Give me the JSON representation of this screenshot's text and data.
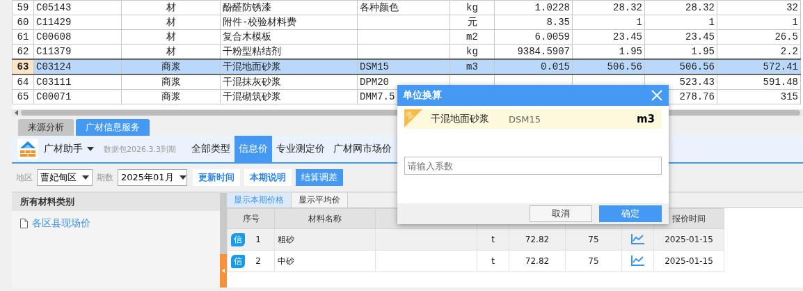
{
  "grid": {
    "rows": [
      {
        "number": "59",
        "selected": false,
        "cells": [
          "C05143",
          "材",
          "酚醛防锈漆",
          "各种颜色",
          "kg",
          "1.0228",
          "28.32",
          "28.32",
          "32"
        ]
      },
      {
        "number": "60",
        "selected": false,
        "cells": [
          "C11429",
          "材",
          "附件-校验材料费",
          null,
          "元",
          "8.35",
          "1",
          "1",
          "1"
        ]
      },
      {
        "number": "61",
        "selected": false,
        "cells": [
          "C00608",
          "材",
          "复合木模板",
          null,
          "m2",
          "6.0059",
          "23.45",
          "23.45",
          "26.5"
        ]
      },
      {
        "number": "62",
        "selected": false,
        "cells": [
          "C11379",
          "材",
          "干粉型粘结剂",
          null,
          "kg",
          "9384.5907",
          "1.95",
          "1.95",
          "2.2"
        ]
      },
      {
        "number": "63",
        "selected": true,
        "cells": [
          "C03124",
          "商浆",
          "干混地面砂浆",
          "DSM15",
          "m3",
          "0.015",
          "506.56",
          "506.56",
          "572.41"
        ]
      },
      {
        "number": "64",
        "selected": false,
        "cells": [
          "C03111",
          "商浆",
          "干混抹灰砂浆",
          "DPM20",
          null,
          null,
          null,
          "523.43",
          "591.48"
        ]
      },
      {
        "number": "65",
        "selected": false,
        "cells": [
          "C00071",
          "商浆",
          "干混砌筑砂浆",
          "DMM7.5",
          null,
          null,
          null,
          "278.76",
          "315"
        ]
      }
    ]
  },
  "panel_tabs": [
    {
      "label": "来源分析",
      "selected": false
    },
    {
      "label": "广材信息服务",
      "selected": true
    }
  ],
  "toolbar": {
    "app_name": "广材助手",
    "expiry": "数据包2026.3.3到期",
    "nav": [
      {
        "label": "全部类型",
        "selected": false
      },
      {
        "label": "信息价",
        "selected": true
      },
      {
        "label": "专业测定价",
        "selected": false
      },
      {
        "label": "广材网市场价",
        "selected": false
      }
    ]
  },
  "filters": {
    "region_label": "地区",
    "region": "曹妃甸区",
    "period_label": "期数",
    "period": "2025年01月",
    "buttons": [
      {
        "label": "更新时间",
        "primary": false
      },
      {
        "label": "本期说明",
        "primary": false
      },
      {
        "label": "结算调差",
        "primary": true
      }
    ]
  },
  "sidebar": {
    "header": "所有材料类别",
    "items": [
      {
        "label": "各区县现场价"
      }
    ]
  },
  "view_tabs": [
    {
      "label": "显示本期价格",
      "selected": true
    },
    {
      "label": "显示平均价",
      "selected": false
    }
  ],
  "price_table": {
    "columns": [
      "序号",
      "材料名称",
      null,
      null,
      null,
      null,
      null,
      "报价时间"
    ],
    "rows": [
      {
        "badge": "信",
        "index": "1",
        "name": "粗砂",
        "unit": "t",
        "price_1": "72.82",
        "price_2": "75",
        "date": "2025-01-15"
      },
      {
        "badge": "信",
        "index": "2",
        "name": "中砂",
        "unit": "t",
        "price_1": "72.82",
        "price_2": "75",
        "date": "2025-01-15"
      }
    ]
  },
  "dialog": {
    "title": "单位换算",
    "tag": "定",
    "material": "干混地面砂浆",
    "spec": "DSM15",
    "unit": "m3",
    "placeholder": "请输入系数",
    "cancel": "取消",
    "ok": "确定"
  }
}
